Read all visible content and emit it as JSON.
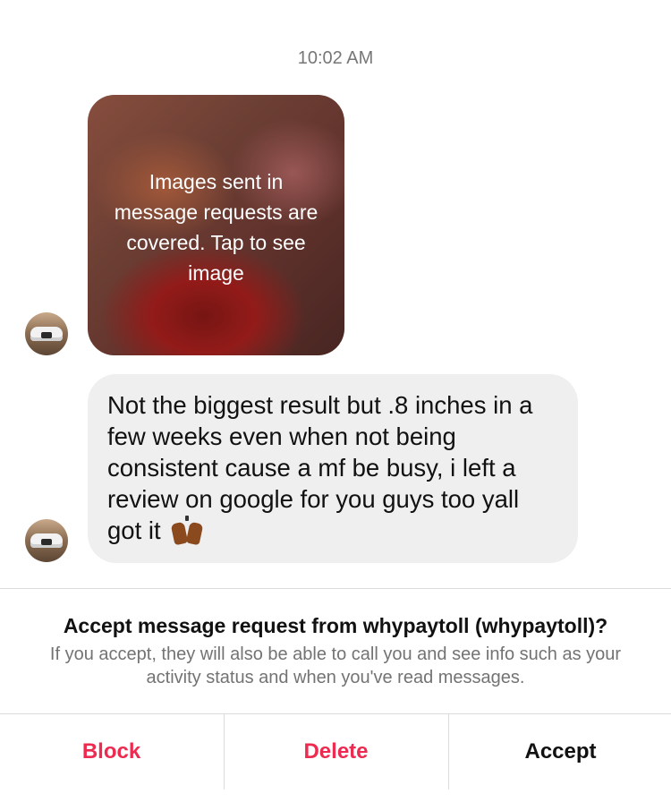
{
  "thread": {
    "timestamp": "10:02 AM",
    "messages": [
      {
        "type": "image",
        "cover_text": "Images sent in message requests are covered. Tap to see image"
      },
      {
        "type": "text",
        "text": "Not the biggest result but .8 inches in a few weeks even when not being consistent cause a mf be busy, i left a review on google for you guys too yall got it",
        "emoji": "raising-hands-emoji"
      }
    ]
  },
  "request": {
    "title": "Accept message request from whypaytoll (whypaytoll)?",
    "description": "If you accept, they will also be able to call you and see info such as your activity status and when you've read messages."
  },
  "actions": {
    "block": "Block",
    "delete": "Delete",
    "accept": "Accept"
  },
  "colors": {
    "danger": "#ed2a4f",
    "bubble": "#efefef",
    "muted_text": "#737373"
  }
}
